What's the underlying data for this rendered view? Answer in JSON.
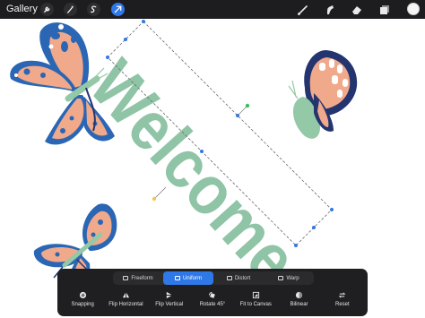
{
  "topbar": {
    "gallery_label": "Gallery",
    "left_tools": [
      {
        "icon": "wrench-icon"
      },
      {
        "icon": "magic-wand-icon"
      },
      {
        "icon": "selection-icon"
      },
      {
        "icon": "transform-arrow-icon",
        "active": true
      }
    ],
    "right_tools": [
      {
        "icon": "brush-icon"
      },
      {
        "icon": "smudge-icon"
      },
      {
        "icon": "eraser-icon"
      },
      {
        "icon": "layers-icon"
      }
    ],
    "current_color": "#f5f5f5"
  },
  "canvas": {
    "welcome_text": "Welcome",
    "welcome_color": "#8fc4a6",
    "colors": {
      "accent": "#2f78e8",
      "butterfly_blue": "#2a66b4",
      "butterfly_peach": "#f0a98a",
      "butterfly_green": "#93c9a6",
      "butterfly_navy": "#23346f"
    }
  },
  "transform_panel": {
    "modes": [
      {
        "label": "Freeform",
        "active": false
      },
      {
        "label": "Uniform",
        "active": true
      },
      {
        "label": "Distort",
        "active": false
      },
      {
        "label": "Warp",
        "active": false
      }
    ],
    "tools": [
      {
        "label": "Snapping",
        "icon": "snapping-icon"
      },
      {
        "label": "Flip Horizontal",
        "icon": "flip-horizontal-icon"
      },
      {
        "label": "Flip Vertical",
        "icon": "flip-vertical-icon"
      },
      {
        "label": "Rotate 45°",
        "icon": "rotate-icon"
      },
      {
        "label": "Fit to Canvas",
        "icon": "fit-canvas-icon"
      },
      {
        "label": "Bilinear",
        "icon": "bilinear-icon"
      },
      {
        "label": "Reset",
        "icon": "reset-icon"
      }
    ]
  }
}
